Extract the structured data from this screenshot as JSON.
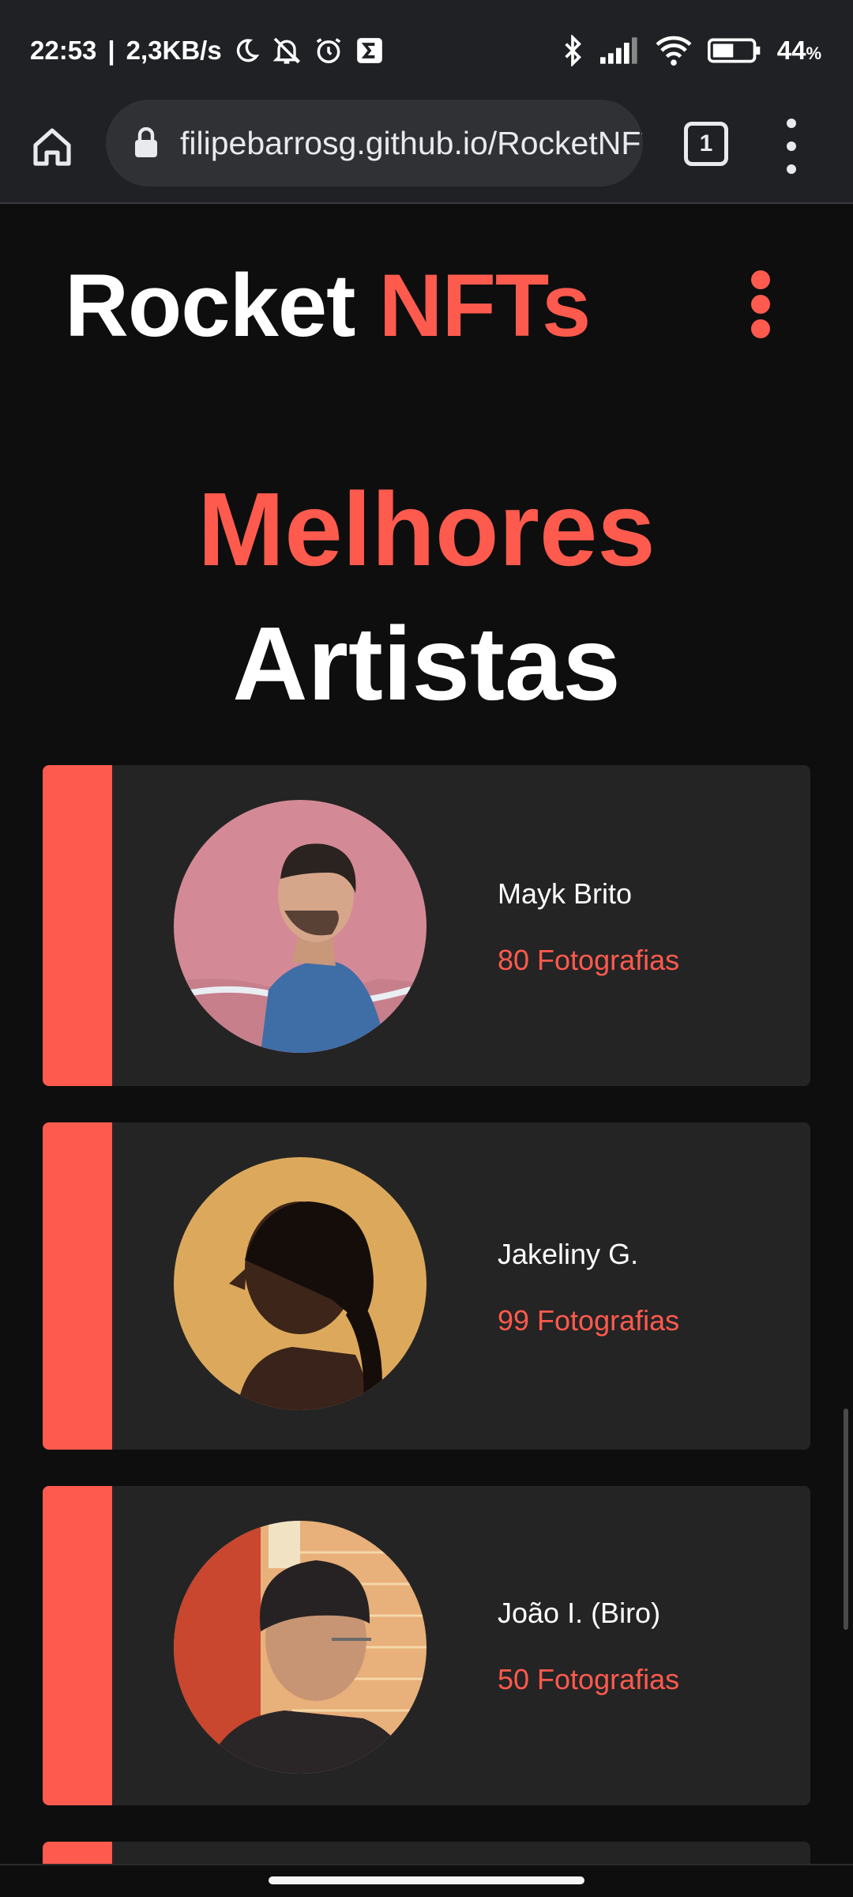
{
  "status_bar": {
    "time": "22:53",
    "separator": "|",
    "network_speed": "2,3KB/s",
    "battery_percent": "44",
    "battery_unit": "%",
    "icons": [
      "moon-icon",
      "mute-icon",
      "alarm-icon",
      "sigma-icon",
      "bluetooth-icon",
      "signal-icon",
      "wifi-icon",
      "battery-icon"
    ]
  },
  "browser": {
    "url": "filipebarrosg.github.io/RocketNFTs",
    "tab_count": "1",
    "icons": [
      "home-icon",
      "lock-icon",
      "tabs-icon",
      "overflow-menu-icon"
    ]
  },
  "page": {
    "logo_main": "Rocket ",
    "logo_accent": "NFTs",
    "hero_line1": "Melhores",
    "hero_line2": "Artistas",
    "accent_color": "#ff5a4e"
  },
  "artists": [
    {
      "name": "Mayk Brito",
      "photos": "80 Fotografias"
    },
    {
      "name": "Jakeliny G.",
      "photos": "99 Fotografias"
    },
    {
      "name": "João I. (Biro)",
      "photos": "50 Fotografias"
    }
  ]
}
